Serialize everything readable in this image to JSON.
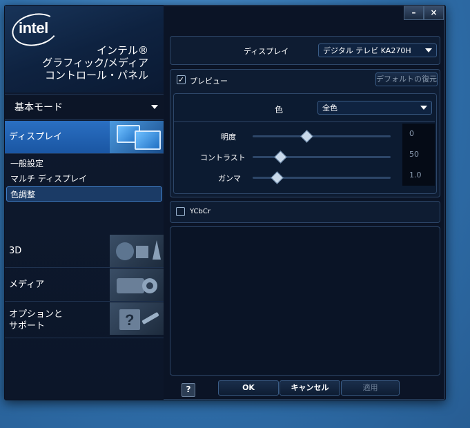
{
  "brand": {
    "logo_text": "intel",
    "title_lines": [
      "インテル®",
      "グラフィック/メディア",
      "コントロール・パネル"
    ]
  },
  "mode": {
    "selected": "基本モード"
  },
  "nav": {
    "display": "ディスプレイ",
    "subitems": [
      "一般設定",
      "マルチ ディスプレイ",
      "色調整"
    ],
    "selected_subitem": "色調整",
    "three_d": "3D",
    "media": "メディア",
    "options_line1": "オプションと",
    "options_line2": "サポート"
  },
  "window_controls": {
    "minimize": "–",
    "close": "×"
  },
  "display_panel": {
    "label": "ディスプレイ",
    "value": "デジタル テレビ KA270H"
  },
  "preview": {
    "label": "プレビュー",
    "checked": true,
    "restore_label": "デフォルトの復元"
  },
  "color": {
    "label": "色",
    "value": "全色"
  },
  "sliders": [
    {
      "label": "明度",
      "value": "0",
      "fraction": 0.39
    },
    {
      "label": "コントラスト",
      "value": "50",
      "fraction": 0.2
    },
    {
      "label": "ガンマ",
      "value": "1.0",
      "fraction": 0.17
    }
  ],
  "ycbcr": {
    "label": "YCbCr",
    "checked": false
  },
  "footer": {
    "help": "?",
    "ok": "OK",
    "cancel": "キャンセル",
    "apply": "適用"
  }
}
